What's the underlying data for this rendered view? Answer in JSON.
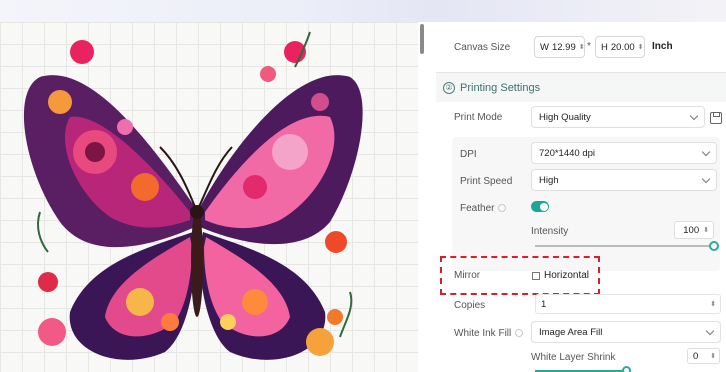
{
  "canvas_size": {
    "label": "Canvas Size",
    "width_prefix": "W",
    "width_value": "12.99",
    "separator": "*",
    "height_prefix": "H",
    "height_value": "20.00",
    "unit": "Inch"
  },
  "printing_settings": {
    "section_number": "②",
    "title": "Printing Settings",
    "print_mode": {
      "label": "Print Mode",
      "value": "High Quality"
    },
    "dpi": {
      "label": "DPI",
      "value": "720*1440 dpi"
    },
    "print_speed": {
      "label": "Print Speed",
      "value": "High"
    },
    "feather": {
      "label": "Feather",
      "enabled": true
    },
    "intensity": {
      "label": "Intensity",
      "value": "100",
      "fraction": 1.0
    },
    "mirror": {
      "label": "Mirror",
      "option_label": "Horizontal",
      "checked": false
    },
    "copies": {
      "label": "Copies",
      "value": "1"
    },
    "white_ink_fill": {
      "label": "White Ink Fill",
      "value": "Image Area Fill"
    },
    "white_layer_shrink": {
      "label": "White Layer Shrink",
      "value": "0"
    }
  },
  "colors": {
    "accent": "#1aa79a",
    "highlight_border": "#d8202b",
    "section_title": "#3f6f69"
  },
  "icons": {
    "spin": "spinner-arrows-icon",
    "dropdown": "chevron-down-icon",
    "save": "save-icon",
    "info": "info-icon"
  }
}
